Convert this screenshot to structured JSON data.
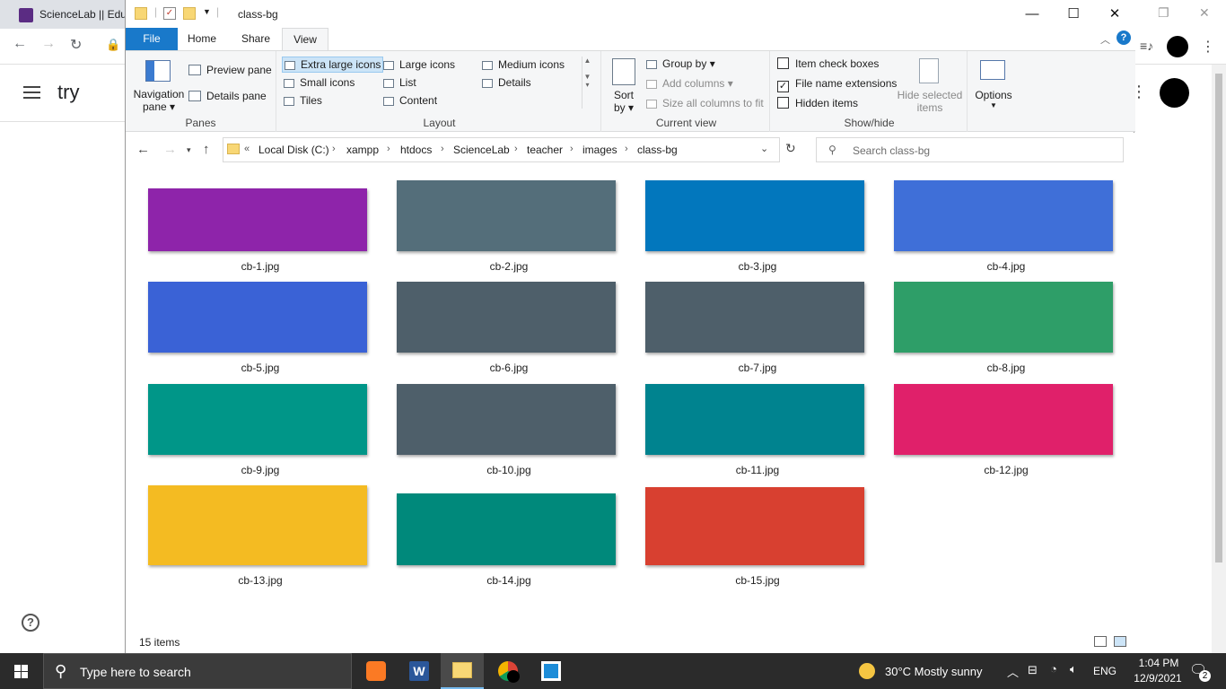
{
  "browser": {
    "tab_title": "ScienceLab || Edu",
    "app_title": "try",
    "help_label": "?"
  },
  "explorer": {
    "window_title": "class-bg",
    "ribbon_tabs": [
      "File",
      "Home",
      "Share",
      "View"
    ],
    "panes": {
      "navigation_pane": "Navigation",
      "navigation_pane2": "pane",
      "preview_pane": "Preview pane",
      "details_pane": "Details pane",
      "label": "Panes"
    },
    "layout": {
      "extra_large_icons": "Extra large icons",
      "large_icons": "Large icons",
      "medium_icons": "Medium icons",
      "small_icons": "Small icons",
      "list": "List",
      "details": "Details",
      "tiles": "Tiles",
      "content": "Content",
      "label": "Layout"
    },
    "current_view": {
      "sort_by": "Sort",
      "sort_by2": "by",
      "group_by": "Group by",
      "add_columns": "Add columns",
      "size_columns": "Size all columns to fit",
      "label": "Current view"
    },
    "show_hide": {
      "item_check_boxes": "Item check boxes",
      "file_name_extensions": "File name extensions",
      "hidden_items": "Hidden items",
      "hide_selected": "Hide selected",
      "hide_selected2": "items",
      "label": "Show/hide",
      "file_name_extensions_checked": true,
      "item_check_boxes_checked": false,
      "hidden_items_checked": false
    },
    "options_label": "Options",
    "path": [
      "Local Disk (C:)",
      "xampp",
      "htdocs",
      "ScienceLab",
      "teacher",
      "images",
      "class-bg"
    ],
    "path_prefix": "«",
    "search_placeholder": "Search class-bg",
    "files": [
      {
        "name": "cb-1.jpg",
        "color": "#8e24aa"
      },
      {
        "name": "cb-2.jpg",
        "color": "#546e7a"
      },
      {
        "name": "cb-3.jpg",
        "color": "#0277bd"
      },
      {
        "name": "cb-4.jpg",
        "color": "#3f6fd8"
      },
      {
        "name": "cb-5.jpg",
        "color": "#3a62d6"
      },
      {
        "name": "cb-6.jpg",
        "color": "#4e5f6a"
      },
      {
        "name": "cb-7.jpg",
        "color": "#4e5f6a"
      },
      {
        "name": "cb-8.jpg",
        "color": "#2e9e68"
      },
      {
        "name": "cb-9.jpg",
        "color": "#009688"
      },
      {
        "name": "cb-10.jpg",
        "color": "#4e5f6a"
      },
      {
        "name": "cb-11.jpg",
        "color": "#00838f"
      },
      {
        "name": "cb-12.jpg",
        "color": "#e0206a"
      },
      {
        "name": "cb-13.jpg",
        "color": "#f4bb22"
      },
      {
        "name": "cb-14.jpg",
        "color": "#00897b"
      },
      {
        "name": "cb-15.jpg",
        "color": "#d84030"
      }
    ],
    "item_count": "15 items"
  },
  "taskbar": {
    "search_text": "Type here to search",
    "weather": "30°C  Mostly sunny",
    "lang": "ENG",
    "time": "1:04 PM",
    "date": "12/9/2021",
    "notifications": "2"
  }
}
